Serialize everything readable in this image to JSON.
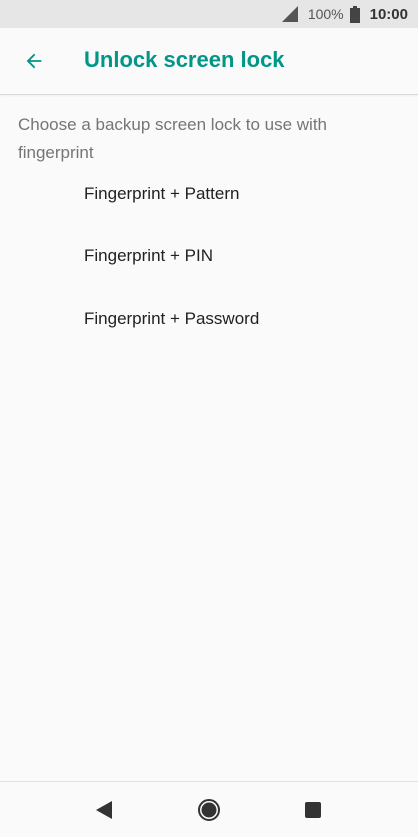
{
  "status_bar": {
    "battery_percent": "100%",
    "time": "10:00",
    "icons": [
      "signal-icon",
      "battery-icon"
    ]
  },
  "app_bar": {
    "title": "Unlock screen lock",
    "back_icon": "back-arrow-icon",
    "accent_color": "#009688"
  },
  "content": {
    "description": "Choose a backup screen lock to use with fingerprint",
    "options": [
      {
        "label": "Fingerprint + Pattern"
      },
      {
        "label": "Fingerprint + PIN"
      },
      {
        "label": "Fingerprint + Password"
      }
    ]
  },
  "nav_bar": {
    "icons": [
      "nav-back-icon",
      "nav-home-icon",
      "nav-recents-icon"
    ]
  }
}
